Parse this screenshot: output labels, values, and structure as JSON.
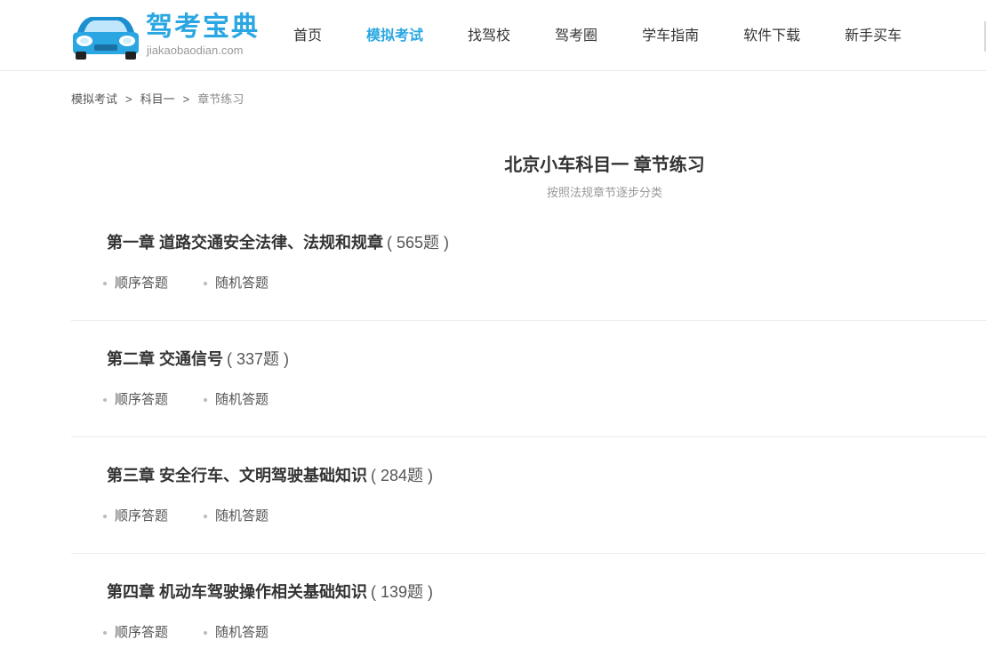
{
  "header": {
    "logo_title": "驾考宝典",
    "logo_sub": "jiakaobaodian.com",
    "nav": [
      {
        "label": "首页"
      },
      {
        "label": "模拟考试"
      },
      {
        "label": "找驾校"
      },
      {
        "label": "驾考圈"
      },
      {
        "label": "学车指南"
      },
      {
        "label": "软件下载"
      },
      {
        "label": "新手买车"
      }
    ],
    "active_nav": "模拟考试",
    "brand_color": "#2aa7e2"
  },
  "breadcrumb": {
    "items": [
      "模拟考试",
      "科目一",
      "章节练习"
    ],
    "separator": ">"
  },
  "page": {
    "title": "北京小车科目一 章节练习",
    "subtitle": "按照法规章节逐步分类"
  },
  "chapters": [
    {
      "name": "第一章 道路交通安全法律、法规和规章",
      "count": "( 565题 )",
      "seq_label": "顺序答题",
      "rand_label": "随机答题"
    },
    {
      "name": "第二章 交通信号",
      "count": "( 337题 )",
      "seq_label": "顺序答题",
      "rand_label": "随机答题"
    },
    {
      "name": "第三章 安全行车、文明驾驶基础知识",
      "count": "( 284题 )",
      "seq_label": "顺序答题",
      "rand_label": "随机答题"
    },
    {
      "name": "第四章 机动车驾驶操作相关基础知识",
      "count": "( 139题 )",
      "seq_label": "顺序答题",
      "rand_label": "随机答题"
    }
  ]
}
